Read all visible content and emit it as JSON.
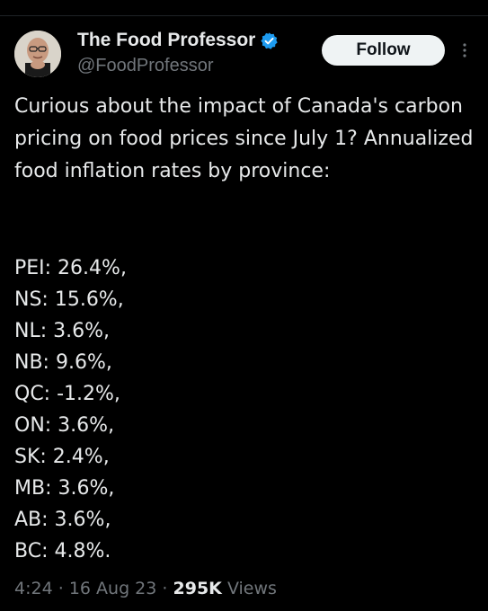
{
  "author": {
    "display_name": "The Food Professor",
    "handle": "@FoodProfessor",
    "verified": true,
    "verified_color": "#1d9bf0"
  },
  "actions": {
    "follow_label": "Follow"
  },
  "tweet": {
    "text": "Curious about the impact of Canada's carbon pricing on food prices since July 1? Annualized food inflation rates by province:",
    "provinces": [
      "PEI: 26.4%,",
      "NS: 15.6%,",
      "NL: 3.6%,",
      "NB: 9.6%,",
      "QC: -1.2%,",
      "ON: 3.6%,",
      "SK: 2.4%,",
      "MB: 3.6%,",
      "AB: 3.6%,",
      "BC: 4.8%."
    ]
  },
  "meta": {
    "time": "4:24",
    "date": "16 Aug 23",
    "views_count": "295K",
    "views_label": "Views"
  },
  "colors": {
    "background": "#000000",
    "text": "#e7e9ea",
    "secondary_text": "#71767b",
    "follow_bg": "#eff3f4"
  }
}
